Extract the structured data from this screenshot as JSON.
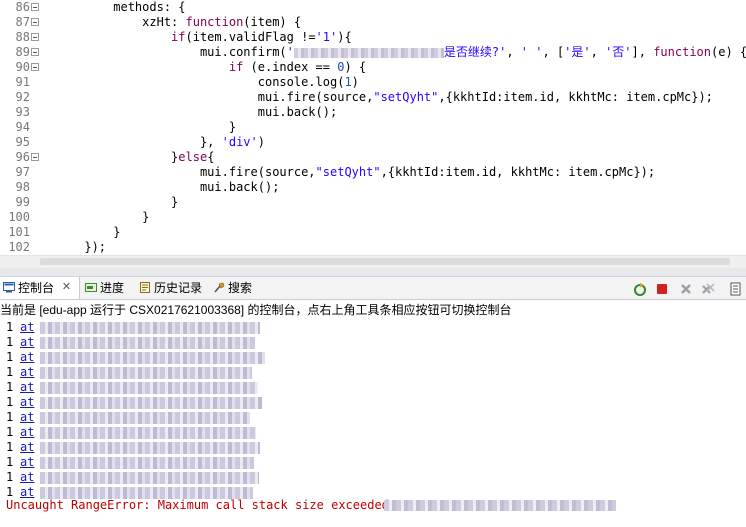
{
  "editor": {
    "lines": [
      {
        "num": "86",
        "fold": true,
        "tokens": [
          [
            "plain",
            "          methods: {"
          ]
        ]
      },
      {
        "num": "87",
        "fold": true,
        "tokens": [
          [
            "plain",
            "              xzHt: "
          ],
          [
            "kw",
            "function"
          ],
          [
            "plain",
            "(item) {"
          ]
        ]
      },
      {
        "num": "88",
        "fold": true,
        "tokens": [
          [
            "plain",
            "                  "
          ],
          [
            "kw",
            "if"
          ],
          [
            "plain",
            "(item.validFlag !="
          ],
          [
            "str",
            "'1'"
          ],
          [
            "plain",
            "){"
          ]
        ]
      },
      {
        "num": "89",
        "fold": true,
        "tokens": [
          [
            "plain",
            "                      mui.confirm("
          ],
          [
            "str",
            "'"
          ],
          [
            "blur",
            "150"
          ],
          [
            "str",
            "是否继续?'"
          ],
          [
            "plain",
            ", "
          ],
          [
            "str",
            "' '"
          ],
          [
            "plain",
            ", ["
          ],
          [
            "str",
            "'是'"
          ],
          [
            "plain",
            ", "
          ],
          [
            "str",
            "'否'"
          ],
          [
            "plain",
            "], "
          ],
          [
            "kw",
            "function"
          ],
          [
            "plain",
            "(e) {"
          ]
        ]
      },
      {
        "num": "90",
        "fold": true,
        "tokens": [
          [
            "plain",
            "                          "
          ],
          [
            "kw",
            "if"
          ],
          [
            "plain",
            " (e.index == "
          ],
          [
            "num",
            "0"
          ],
          [
            "plain",
            ") {"
          ]
        ]
      },
      {
        "num": "91",
        "fold": false,
        "tokens": [
          [
            "plain",
            "                              console.log("
          ],
          [
            "num",
            "1"
          ],
          [
            "plain",
            ")"
          ]
        ]
      },
      {
        "num": "92",
        "fold": false,
        "tokens": [
          [
            "plain",
            "                              mui.fire(source,"
          ],
          [
            "str",
            "\"setQyht\""
          ],
          [
            "plain",
            ",{kkhtId:item.id, kkhtMc: item.cpMc});"
          ]
        ]
      },
      {
        "num": "93",
        "fold": false,
        "tokens": [
          [
            "plain",
            "                              mui.back();"
          ]
        ]
      },
      {
        "num": "94",
        "fold": false,
        "tokens": [
          [
            "plain",
            "                          }"
          ]
        ]
      },
      {
        "num": "95",
        "fold": false,
        "tokens": [
          [
            "plain",
            "                      }, "
          ],
          [
            "str",
            "'div'"
          ],
          [
            "plain",
            ")"
          ]
        ]
      },
      {
        "num": "96",
        "fold": true,
        "tokens": [
          [
            "plain",
            "                  }"
          ],
          [
            "kw",
            "else"
          ],
          [
            "plain",
            "{"
          ]
        ]
      },
      {
        "num": "97",
        "fold": false,
        "tokens": [
          [
            "plain",
            "                      mui.fire(source,"
          ],
          [
            "str",
            "\"setQyht\""
          ],
          [
            "plain",
            ",{kkhtId:item.id, kkhtMc: item.cpMc});"
          ]
        ]
      },
      {
        "num": "98",
        "fold": false,
        "tokens": [
          [
            "plain",
            "                      mui.back();"
          ]
        ]
      },
      {
        "num": "99",
        "fold": false,
        "tokens": [
          [
            "plain",
            "                  }"
          ]
        ]
      },
      {
        "num": "100",
        "fold": false,
        "tokens": [
          [
            "plain",
            "              }"
          ]
        ]
      },
      {
        "num": "101",
        "fold": false,
        "tokens": [
          [
            "plain",
            "          }"
          ]
        ]
      },
      {
        "num": "102",
        "fold": false,
        "tokens": [
          [
            "plain",
            "      });"
          ]
        ]
      }
    ]
  },
  "tabs": [
    {
      "label": "控制台",
      "icon": "console-icon",
      "active": true
    },
    {
      "label": "进度",
      "icon": "progress-icon",
      "active": false
    },
    {
      "label": "历史记录",
      "icon": "history-icon",
      "active": false
    },
    {
      "label": "搜索",
      "icon": "search-icon",
      "active": false
    }
  ],
  "tab_close_glyph": "✕",
  "toolbar_icons": [
    "run-icon",
    "stop-icon",
    "remove-icon",
    "remove-all-icon",
    "display-console-icon"
  ],
  "status_text": "当前是 [edu-app 运行于 CSX0217621003368] 的控制台，点右上角工具条相应按钮可切换控制台",
  "console": {
    "lines": [
      {
        "count": "1",
        "link": "at"
      },
      {
        "count": "1",
        "link": "at"
      },
      {
        "count": "1",
        "link": "at"
      },
      {
        "count": "1",
        "link": "at"
      },
      {
        "count": "1",
        "link": "at"
      },
      {
        "count": "1",
        "link": "at"
      },
      {
        "count": "1",
        "link": "at"
      },
      {
        "count": "1",
        "link": "at"
      },
      {
        "count": "1",
        "link": "at"
      },
      {
        "count": "1",
        "link": "at"
      },
      {
        "count": "1",
        "link": "at"
      },
      {
        "count": "1",
        "link": "at"
      }
    ],
    "error": "Uncaught RangeError: Maximum call stack size exceeded"
  }
}
